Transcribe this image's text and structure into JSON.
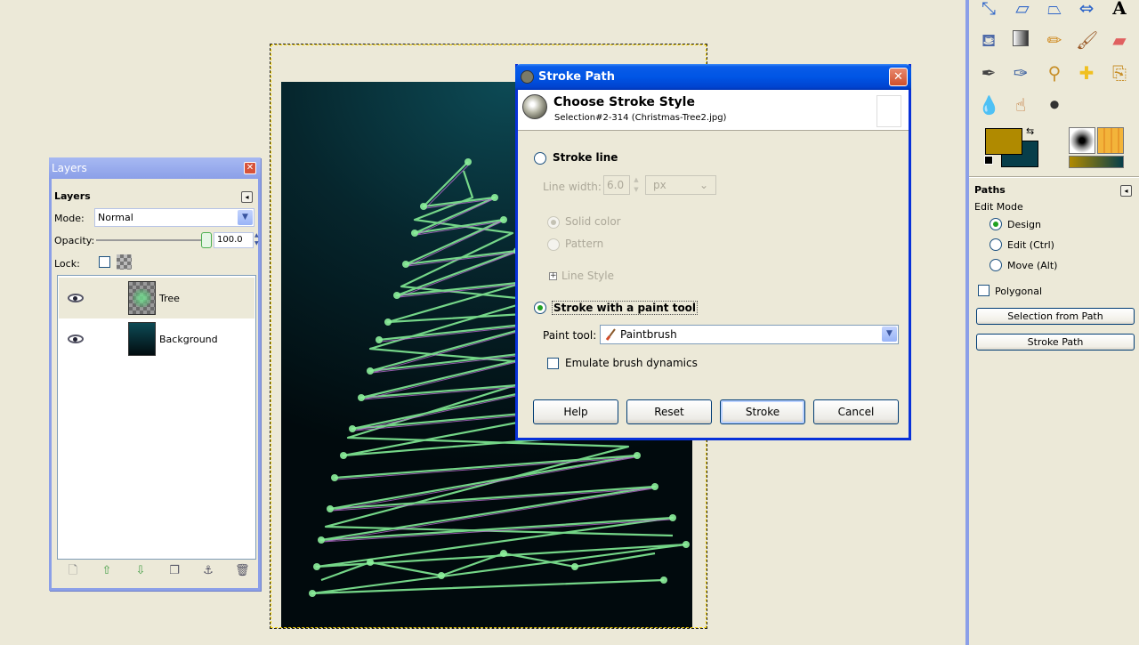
{
  "layers_window": {
    "title": "Layers",
    "header": "Layers",
    "mode_label": "Mode:",
    "mode_value": "Normal",
    "opacity_label": "Opacity:",
    "opacity_value": "100.0",
    "lock_label": "Lock:",
    "layers": [
      {
        "name": "Tree",
        "visible": true,
        "selected": true
      },
      {
        "name": "Background",
        "visible": true,
        "selected": false
      }
    ],
    "bottom_buttons": [
      "new-layer-icon",
      "raise-layer-icon",
      "lower-layer-icon",
      "duplicate-layer-icon",
      "anchor-layer-icon",
      "delete-layer-icon"
    ]
  },
  "stroke_dialog": {
    "title": "Stroke Path",
    "heading": "Choose Stroke Style",
    "subheading": "Selection#2-314 (Christmas-Tree2.jpg)",
    "stroke_line_label": "Stroke line",
    "line_width_label": "Line width:",
    "line_width_value": "6.0",
    "unit_value": "px",
    "solid_color_label": "Solid color",
    "pattern_label": "Pattern",
    "line_style_label": "Line Style",
    "stroke_paint_tool_label": "Stroke with a paint tool",
    "paint_tool_label": "Paint tool:",
    "paint_tool_value": "Paintbrush",
    "emulate_label": "Emulate brush dynamics",
    "buttons": {
      "help": "Help",
      "reset": "Reset",
      "stroke": "Stroke",
      "cancel": "Cancel"
    }
  },
  "toolbox": {
    "colors": {
      "foreground": "#b08a00",
      "background": "#073e4a"
    },
    "paths_header": "Paths",
    "edit_mode_label": "Edit Mode",
    "modes": [
      "Design",
      "Edit (Ctrl)",
      "Move (Alt)"
    ],
    "selected_mode": "Design",
    "polygonal_label": "Polygonal",
    "selection_from_path": "Selection from Path",
    "stroke_path": "Stroke Path"
  }
}
